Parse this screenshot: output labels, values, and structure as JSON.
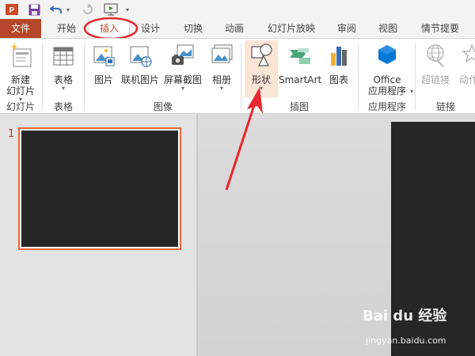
{
  "quick_access": {
    "app_icon_letter": "P",
    "undo_caret": "▾",
    "customize_caret": "▾"
  },
  "tabs": [
    {
      "id": "file",
      "label": "文件"
    },
    {
      "id": "home",
      "label": "开始"
    },
    {
      "id": "insert",
      "label": "插入"
    },
    {
      "id": "design",
      "label": "设计"
    },
    {
      "id": "transitions",
      "label": "切换"
    },
    {
      "id": "animations",
      "label": "动画"
    },
    {
      "id": "slideshow",
      "label": "幻灯片放映"
    },
    {
      "id": "review",
      "label": "审阅"
    },
    {
      "id": "view",
      "label": "视图"
    },
    {
      "id": "storyboard",
      "label": "情节提要"
    }
  ],
  "ribbon": {
    "new_slide_line1": "新建",
    "new_slide_line2": "幻灯片",
    "table": "表格",
    "picture": "图片",
    "online_picture": "联机图片",
    "screenshot": "屏幕截图",
    "album": "相册",
    "shapes": "形状",
    "smartart": "SmartArt",
    "chart": "图表",
    "office_line1": "Office",
    "office_line2": "应用程序",
    "hyperlink": "超链接",
    "action": "动作",
    "caret": "▾",
    "groups": {
      "slides": "幻灯片",
      "tables": "表格",
      "images": "图像",
      "illustrations": "插图",
      "apps": "应用程序",
      "links": "链接"
    }
  },
  "thumbnails": {
    "slide_number": "1"
  },
  "watermark": {
    "brand": "Bai du 经验",
    "url": "jingyan.baidu.com"
  },
  "colors": {
    "accent": "#b7472a",
    "annotation_red": "#e8262d",
    "slide_dark": "#262626",
    "office_blue": "#0078d7"
  }
}
